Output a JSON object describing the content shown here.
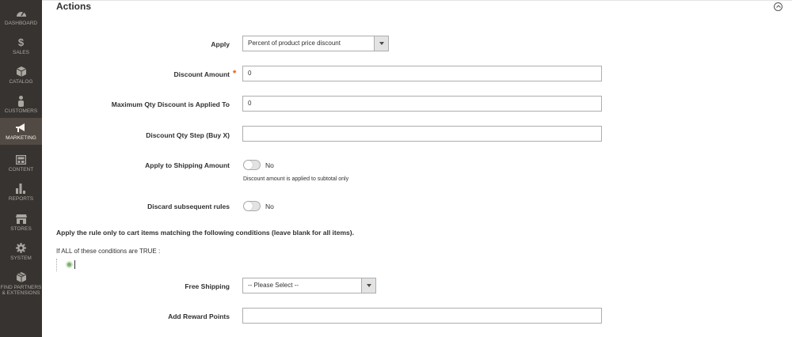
{
  "sidebar": {
    "items": [
      {
        "label": "DASHBOARD",
        "icon": "dashboard-icon",
        "active": false
      },
      {
        "label": "SALES",
        "icon": "dollar-icon",
        "active": false
      },
      {
        "label": "CATALOG",
        "icon": "cube-icon",
        "active": false
      },
      {
        "label": "CUSTOMERS",
        "icon": "person-icon",
        "active": false
      },
      {
        "label": "MARKETING",
        "icon": "megaphone-icon",
        "active": true
      },
      {
        "label": "CONTENT",
        "icon": "layout-icon",
        "active": false
      },
      {
        "label": "REPORTS",
        "icon": "bar-chart-icon",
        "active": false
      },
      {
        "label": "STORES",
        "icon": "storefront-icon",
        "active": false
      },
      {
        "label": "SYSTEM",
        "icon": "gear-icon",
        "active": false
      },
      {
        "label": "FIND PARTNERS",
        "label2": "& EXTENSIONS",
        "icon": "box-icon",
        "active": false
      }
    ]
  },
  "section": {
    "title": "Actions"
  },
  "form": {
    "apply_label": "Apply",
    "apply_value": "Percent of product price discount",
    "discount_amount_label": "Discount Amount",
    "discount_amount_required": "*",
    "discount_amount_value": "0",
    "max_qty_label": "Maximum Qty Discount is Applied To",
    "max_qty_value": "0",
    "qty_step_label": "Discount Qty Step (Buy X)",
    "qty_step_value": "",
    "shipping_label": "Apply to Shipping Amount",
    "shipping_toggle": "No",
    "shipping_note": "Discount amount is applied to subtotal only",
    "discard_label": "Discard subsequent rules",
    "discard_toggle": "No",
    "conditions_heading": "Apply the rule only to cart items matching the following conditions (leave blank for all items).",
    "conditions_if": "If ALL",
    "conditions_rest": " of these conditions are TRUE :",
    "free_shipping_label": "Free Shipping",
    "free_shipping_value": "-- Please Select --",
    "reward_points_label": "Add Reward Points",
    "reward_points_value": ""
  },
  "colors": {
    "sidebar_bg": "#373330",
    "sidebar_active": "#514943",
    "required": "#eb5202"
  }
}
